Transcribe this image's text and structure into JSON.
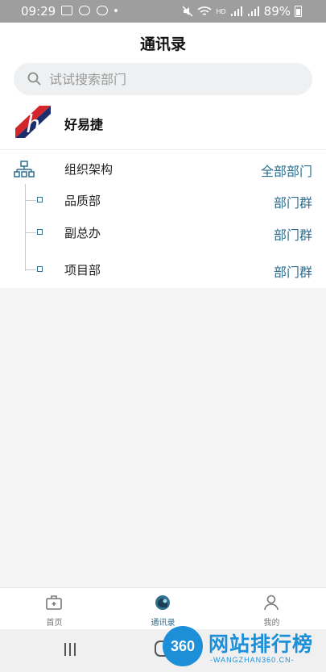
{
  "status_bar": {
    "time": "09:29",
    "battery": "89%",
    "network_label": "HD"
  },
  "header": {
    "title": "通讯录"
  },
  "search": {
    "placeholder": "试试搜索部门"
  },
  "company": {
    "name": "好易捷",
    "logo_letter": "h"
  },
  "org": {
    "label": "组织架构",
    "link": "全部部门",
    "departments": [
      {
        "name": "品质部",
        "link": "部门群"
      },
      {
        "name": "副总办",
        "link": "部门群"
      },
      {
        "name": "项目部",
        "link": "部门群"
      }
    ]
  },
  "bottom_nav": {
    "items": [
      {
        "label": "首页",
        "icon": "briefcase-icon"
      },
      {
        "label": "通讯录",
        "icon": "contacts-chat-icon",
        "active": true
      },
      {
        "label": "我的",
        "icon": "person-icon"
      }
    ]
  },
  "watermark": {
    "badge": "360",
    "title": "网站排行榜",
    "subtitle": "-WANGZHAN360.CN-"
  },
  "colors": {
    "accent": "#2f6f8f",
    "logo_bg": "#1b2d6b",
    "logo_red": "#d2262b",
    "watermark": "#1d8fd8"
  }
}
